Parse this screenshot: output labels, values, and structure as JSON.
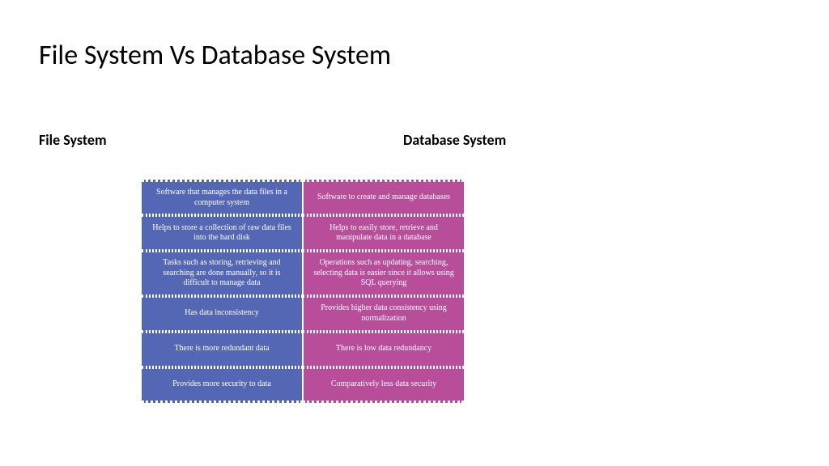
{
  "title": "File System Vs Database System",
  "headings": {
    "left": "File System",
    "right": "Database System"
  },
  "rows": [
    {
      "left": "Software that manages the data files in a computer system",
      "right": "Software to create and manage databases"
    },
    {
      "left": "Helps to store a collection of raw data files into the hard disk",
      "right": "Helps to easily store, retrieve and manipulate data in a database"
    },
    {
      "left": "Tasks such as storing, retrieving and searching are done manually, so it is difficult to manage data",
      "right": "Operations such as updating, searching, selecting data is easier since it allows using SQL querying"
    },
    {
      "left": "Has data inconsistency",
      "right": "Provides higher data consistency using normalization"
    },
    {
      "left": "There is more redundant data",
      "right": "There is low data redundancy"
    },
    {
      "left": "Provides more security to data",
      "right": "Comparatively less data security"
    }
  ]
}
